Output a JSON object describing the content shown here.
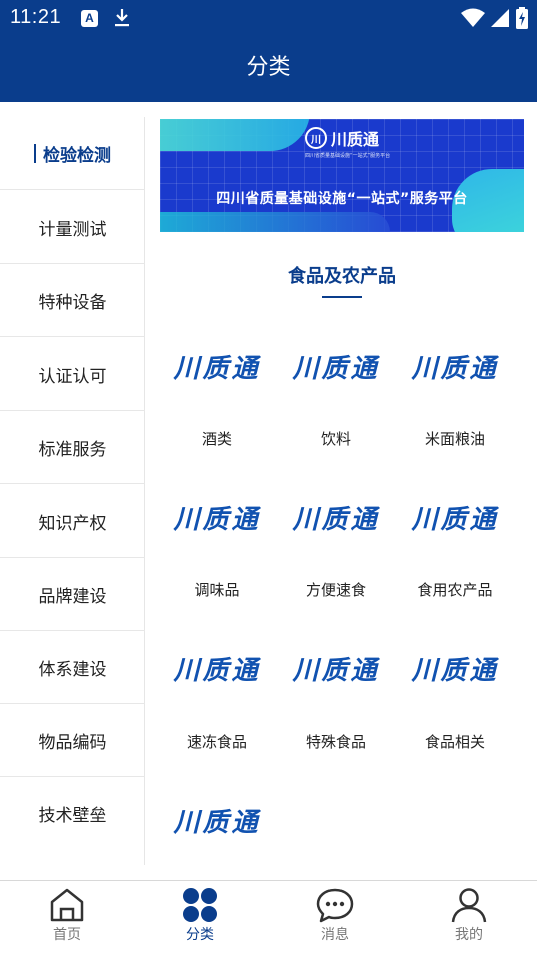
{
  "status_bar": {
    "time": "11:21",
    "notification_badge": "A"
  },
  "header": {
    "title": "分类"
  },
  "sidebar": {
    "items": [
      {
        "label": "检验检测",
        "active": true
      },
      {
        "label": "计量测试",
        "active": false
      },
      {
        "label": "特种设备",
        "active": false
      },
      {
        "label": "认证认可",
        "active": false
      },
      {
        "label": "标准服务",
        "active": false
      },
      {
        "label": "知识产权",
        "active": false
      },
      {
        "label": "品牌建设",
        "active": false
      },
      {
        "label": "体系建设",
        "active": false
      },
      {
        "label": "物品编码",
        "active": false
      },
      {
        "label": "技术壁垒",
        "active": false
      }
    ]
  },
  "banner": {
    "logo_text": "川质通",
    "subtitle": "四川省质量基础设施“一站式”服务平台",
    "title": "四川省质量基础设施“一站式”服务平台"
  },
  "section": {
    "title": "食品及农产品"
  },
  "categories": {
    "logo_text": "川质通",
    "items": [
      {
        "label": "酒类"
      },
      {
        "label": "饮料"
      },
      {
        "label": "米面粮油"
      },
      {
        "label": "调味品"
      },
      {
        "label": "方便速食"
      },
      {
        "label": "食用农产品"
      },
      {
        "label": "速冻食品"
      },
      {
        "label": "特殊食品"
      },
      {
        "label": "食品相关"
      },
      {
        "label": ""
      }
    ]
  },
  "bottom_nav": {
    "items": [
      {
        "label": "首页",
        "icon": "home-icon",
        "active": false
      },
      {
        "label": "分类",
        "icon": "category-icon",
        "active": true
      },
      {
        "label": "消息",
        "icon": "message-icon",
        "active": false
      },
      {
        "label": "我的",
        "icon": "profile-icon",
        "active": false
      }
    ]
  },
  "colors": {
    "primary": "#0a3d8c",
    "logo_blue": "#1152b0",
    "banner_blue": "#1a3acd",
    "nav_inactive": "#777777"
  }
}
